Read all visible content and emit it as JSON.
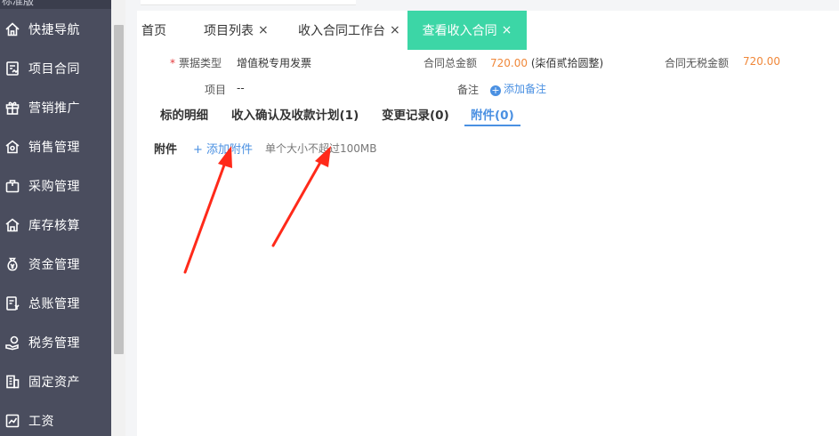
{
  "sidebar": {
    "top_label": "标准版",
    "items": [
      {
        "label": "快捷导航",
        "icon": "home-icon"
      },
      {
        "label": "项目合同",
        "icon": "contract-icon"
      },
      {
        "label": "营销推广",
        "icon": "gift-icon"
      },
      {
        "label": "销售管理",
        "icon": "sales-icon"
      },
      {
        "label": "采购管理",
        "icon": "briefcase-icon"
      },
      {
        "label": "库存核算",
        "icon": "warehouse-icon"
      },
      {
        "label": "资金管理",
        "icon": "money-bag-icon"
      },
      {
        "label": "总账管理",
        "icon": "ledger-icon"
      },
      {
        "label": "税务管理",
        "icon": "hand-coin-icon"
      },
      {
        "label": "固定资产",
        "icon": "building-icon"
      },
      {
        "label": "工资",
        "icon": "salary-icon"
      }
    ]
  },
  "tabs": [
    {
      "label": "首页",
      "closable": false
    },
    {
      "label": "项目列表",
      "closable": true
    },
    {
      "label": "收入合同工作台",
      "closable": true
    },
    {
      "label": "查看收入合同",
      "closable": true,
      "active": true
    }
  ],
  "close_glyph": "×",
  "form": {
    "invoice_type_label": "票据类型",
    "invoice_type_value": "增值税专用发票",
    "total_amount_label": "合同总金额",
    "total_amount_value": "720.00",
    "total_amount_words": "(柒佰贰拾圆整)",
    "no_tax_amount_label": "合同无税金额",
    "no_tax_amount_value": "720.00",
    "project_label": "项目",
    "project_value": "--",
    "remark_label": "备注",
    "add_remark": "添加备注"
  },
  "subtabs": [
    {
      "label": "标的明细"
    },
    {
      "label": "收入确认及收款计划(1)"
    },
    {
      "label": "变更记录(0)"
    },
    {
      "label": "附件(0)",
      "active": true
    }
  ],
  "attachments": {
    "title": "附件",
    "add_label": "+ 添加附件",
    "hint": "单个大小不超过100MB"
  },
  "colors": {
    "sidebar_bg": "#4a4d5e",
    "active_tab": "#3cd6a6",
    "link": "#4a90e2",
    "amount": "#f0883a",
    "arrow": "#ff2a1a"
  }
}
